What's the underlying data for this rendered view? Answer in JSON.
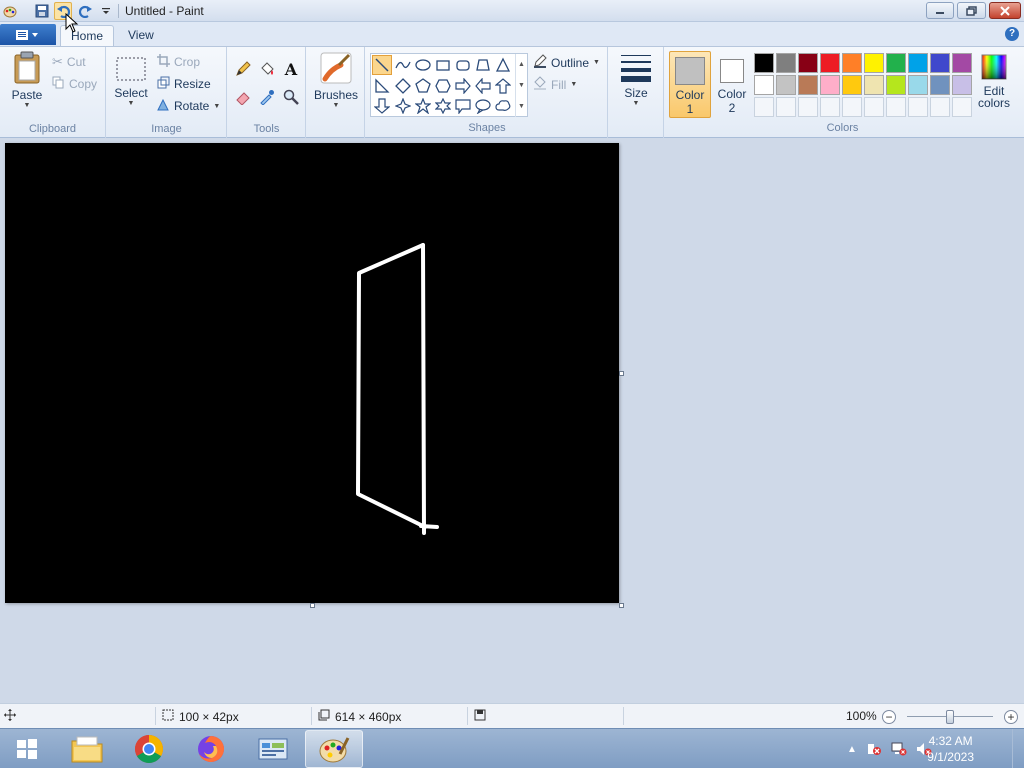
{
  "window": {
    "title": "Untitled - Paint"
  },
  "tabs": [
    {
      "label": "Home"
    },
    {
      "label": "View"
    }
  ],
  "clipboard": {
    "paste_label": "Paste",
    "cut_label": "Cut",
    "copy_label": "Copy",
    "group_label": "Clipboard"
  },
  "image": {
    "select_label": "Select",
    "crop_label": "Crop",
    "resize_label": "Resize",
    "rotate_label": "Rotate",
    "group_label": "Image"
  },
  "tools": {
    "group_label": "Tools",
    "icons": [
      "pencil-icon",
      "fill-icon",
      "text-icon",
      "eraser-icon",
      "color-picker-icon",
      "magnifier-icon"
    ]
  },
  "brushes": {
    "label": "Brushes"
  },
  "shapes": {
    "group_label": "Shapes",
    "outline_label": "Outline",
    "fill_label": "Fill",
    "selected": "line"
  },
  "size": {
    "label": "Size"
  },
  "colors": {
    "color1_label": "Color",
    "color1_num": "1",
    "color2_label": "Color",
    "color2_num": "2",
    "edit_label": "Edit",
    "edit_label2": "colors",
    "group_label": "Colors",
    "color1_value": "#c0c0c0",
    "color2_value": "#ffffff",
    "palette_row1": [
      "#000000",
      "#7f7f7f",
      "#880015",
      "#ed1c24",
      "#ff7f27",
      "#fff200",
      "#22b14c",
      "#00a2e8",
      "#3f48cc",
      "#a349a4"
    ],
    "palette_row2": [
      "#ffffff",
      "#c3c3c3",
      "#b97a57",
      "#ffaec9",
      "#ffc90e",
      "#efe4b0",
      "#b5e61d",
      "#99d9ea",
      "#7092be",
      "#c8bfe7"
    ]
  },
  "canvas": {
    "background": "#000000",
    "stroke_color": "#ffffff"
  },
  "status": {
    "selection_size": "100 × 42px",
    "canvas_size": "614 × 460px",
    "zoom": "100%"
  },
  "taskbar": {
    "time": "4:32 AM",
    "date": "9/1/2023",
    "apps": [
      "file-explorer-icon",
      "chrome-icon",
      "firefox-icon",
      "control-panel-icon",
      "paint-icon"
    ]
  }
}
